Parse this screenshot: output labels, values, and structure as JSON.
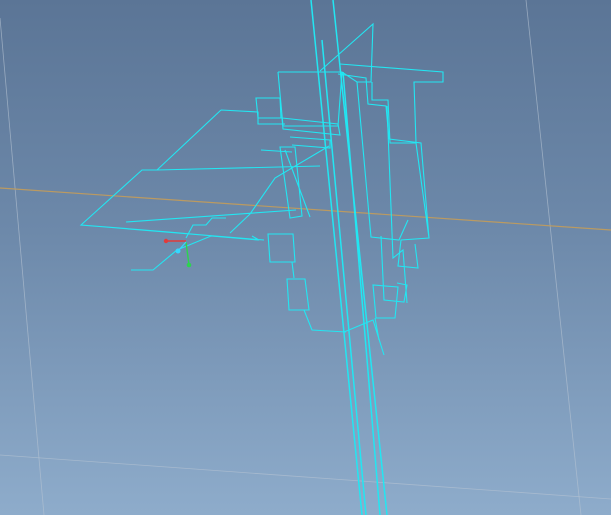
{
  "scene": {
    "background_top": "#5b7596",
    "background_bottom": "#8eaccb",
    "wire_color": "#22e6f2",
    "axis_x_color": "#e23b3b",
    "axis_y_color": "#2cd44f",
    "origin_color": "#35d7ff",
    "grid_color": "#b7c4d3",
    "horizon_color": "#c49d5a"
  }
}
